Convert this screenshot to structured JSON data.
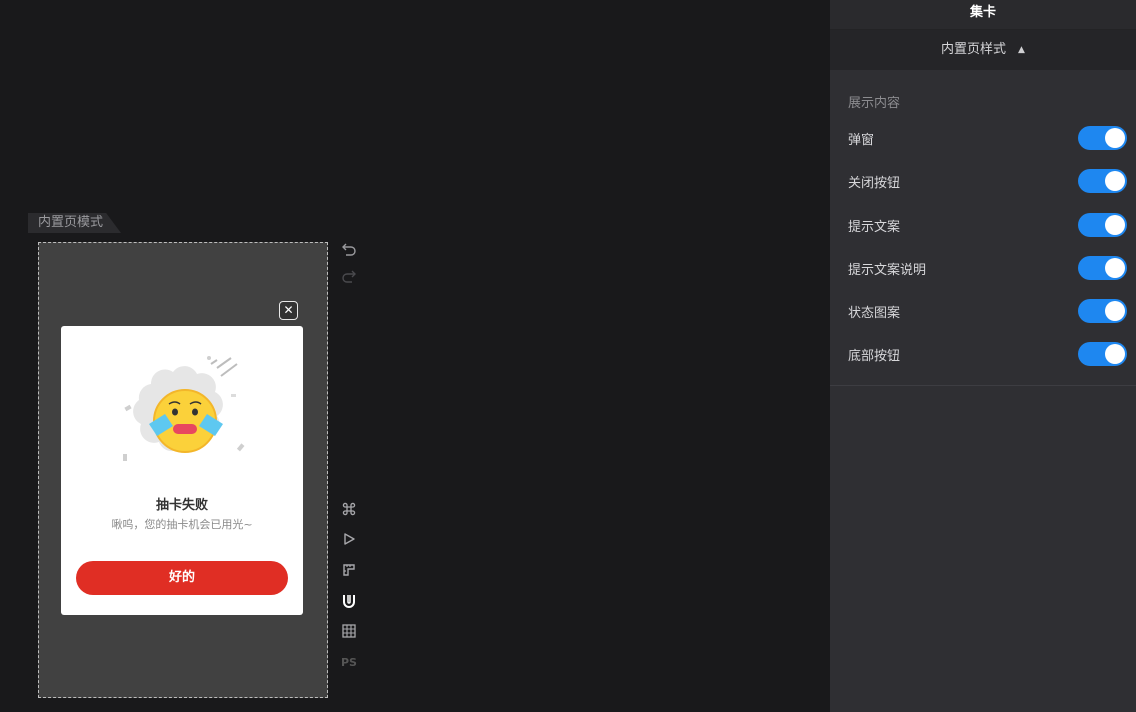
{
  "canvas": {
    "mode_tag": "内置页模式",
    "popup": {
      "close_symbol": "✕",
      "title": "抽卡失败",
      "description": "啾呜，您的抽卡机会已用光~",
      "button_label": "好的"
    },
    "toolbar": {
      "items": [
        "undo-icon",
        "redo-icon",
        "command-icon",
        "play-icon",
        "ruler-icon",
        "magnet-icon",
        "grid-icon",
        "ps-icon"
      ],
      "ps_label": "PS"
    }
  },
  "panel": {
    "title": "集卡",
    "section": {
      "title": "内置页样式",
      "caret": "▲",
      "content_label": "展示内容",
      "toggles": [
        {
          "label": "弹窗",
          "on": true
        },
        {
          "label": "关闭按钮",
          "on": true
        },
        {
          "label": "提示文案",
          "on": true
        },
        {
          "label": "提示文案说明",
          "on": true
        },
        {
          "label": "状态图案",
          "on": true
        },
        {
          "label": "底部按钮",
          "on": true
        }
      ]
    }
  },
  "colors": {
    "accent_blue": "#1e87f0",
    "popup_button_red": "#e02e24",
    "background": "#19191b",
    "panel_background": "#2f2f33"
  }
}
